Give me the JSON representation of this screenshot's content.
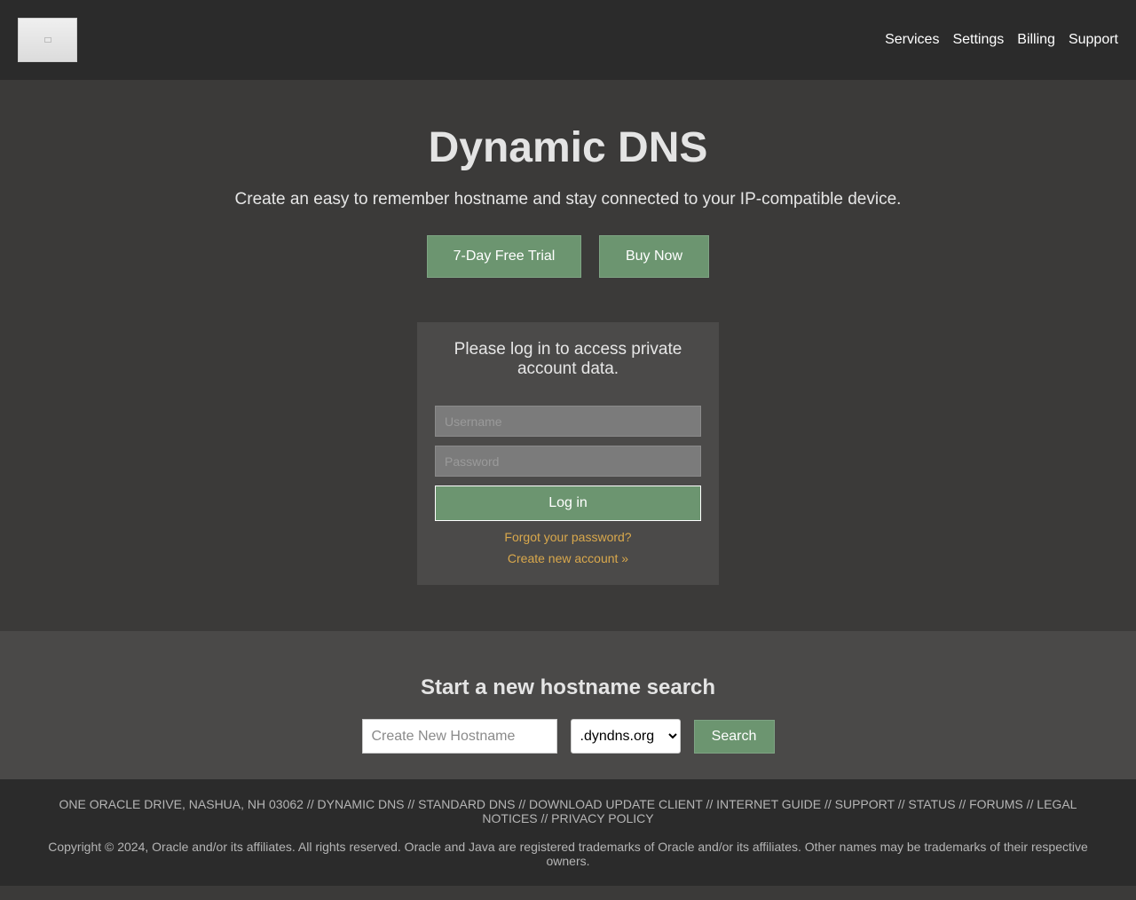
{
  "header": {
    "nav": [
      "Services",
      "Settings",
      "Billing",
      "Support"
    ]
  },
  "hero": {
    "title": "Dynamic DNS",
    "subtitle": "Create an easy to remember hostname and stay connected to your IP-compatible device.",
    "trial_label": "7-Day Free Trial",
    "buy_label": "Buy Now"
  },
  "login": {
    "message": "Please log in to access private account data.",
    "username_placeholder": "Username",
    "password_placeholder": "Password",
    "button_label": "Log in",
    "forgot_label": "Forgot your password?",
    "create_label": "Create new account »"
  },
  "search": {
    "heading": "Start a new hostname search",
    "input_placeholder": "Create New Hostname",
    "domain_selected": ".dyndns.org",
    "button_label": "Search"
  },
  "footer": {
    "links": "ONE ORACLE DRIVE, NASHUA, NH 03062 // DYNAMIC DNS // STANDARD DNS // DOWNLOAD UPDATE CLIENT // INTERNET GUIDE // SUPPORT // STATUS // FORUMS // LEGAL NOTICES // PRIVACY POLICY",
    "copyright": "Copyright © 2024, Oracle and/or its affiliates. All rights reserved. Oracle and Java are registered trademarks of Oracle and/or its affiliates. Other names may be trademarks of their respective owners."
  },
  "colors": {
    "accent_green": "#6c9570",
    "link_gold": "#d9a84c",
    "hero_bg": "#3b3a39",
    "header_bg": "#2b2b2b"
  }
}
